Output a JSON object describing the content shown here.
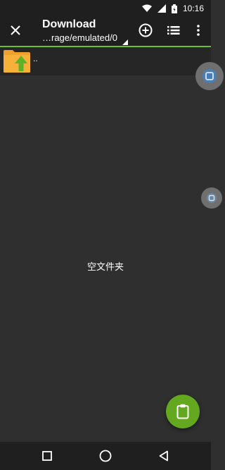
{
  "status_bar": {
    "time": "10:16",
    "icons": [
      "wifi-icon",
      "signal-icon",
      "battery-icon"
    ]
  },
  "app_bar": {
    "title": "Download",
    "path": "…rage/emulated/0",
    "actions": [
      "add-circle-icon",
      "list-view-icon",
      "more-vert-icon"
    ],
    "accent_color": "#6fbf2a"
  },
  "file_list": {
    "parent_label": ".."
  },
  "empty_state": {
    "text": "空文件夹"
  },
  "fab": {
    "icon": "clipboard-icon",
    "color": "#63a81f"
  },
  "nav_bar": {
    "buttons": [
      "recents-icon",
      "home-icon",
      "back-icon"
    ]
  }
}
